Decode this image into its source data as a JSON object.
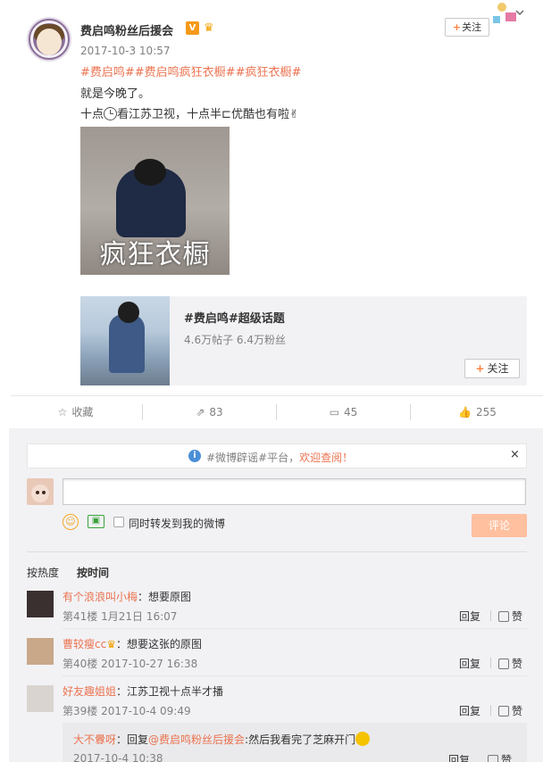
{
  "post": {
    "author": "费启鸣粉丝后援会",
    "verified_badge": "V",
    "member_badge": "♛",
    "follow_label": "关注",
    "timestamp": "2017-10-3 10:57",
    "hashtags": "#费启鸣##费启鸣疯狂衣橱##疯狂衣橱#",
    "line1": "就是今晚了。",
    "line2_a": "十点",
    "line2_b": "看江苏卫视，十点半",
    "line2_c": "优酷也有啦",
    "line2_c_glyph": "⊏",
    "peace_emoji": "✌",
    "image_caption": "疯狂衣橱"
  },
  "topic_card": {
    "title": "#费启鸣#超级话题",
    "meta": "4.6万帖子 6.4万粉丝",
    "follow_label": "关注"
  },
  "actions": {
    "favorite_label": "收藏",
    "forward_count": "83",
    "comment_count": "45",
    "like_count": "255"
  },
  "comment_box": {
    "notice_text_a": "#微博辟谣#平台，",
    "notice_text_b": "欢迎查阅！",
    "close": "×",
    "repost_label": "同时转发到我的微博",
    "submit_label": "评论",
    "placeholder": ""
  },
  "sort": {
    "by_heat": "按热度",
    "by_time": "按时间"
  },
  "comments": [
    {
      "name": "有个浪浪叫小梅",
      "text": "：想要原图",
      "meta": "第41楼 1月21日 16:07",
      "reply": "回复",
      "like": "赞"
    },
    {
      "name": "曹较瘦cc",
      "text": "：想要这张的原图",
      "meta": "第40楼 2017-10-27 16:38",
      "reply": "回复",
      "like": "赞"
    },
    {
      "name": "好友趣姐姐",
      "text": "：江苏卫视十点半才播",
      "meta": "第39楼 2017-10-4 09:49",
      "reply": "回复",
      "like": "赞"
    }
  ],
  "nested_reply": {
    "name": "大不釁呀",
    "prefix": "：回复",
    "at": "@费启鸣粉丝后援会",
    "text": ":然后我看完了芝麻开门",
    "meta": "2017-10-4 10:38",
    "reply": "回复",
    "like": "赞"
  },
  "icons": {
    "star": "☆",
    "forward": "⇗",
    "comment": "▭",
    "like": "👍",
    "info": "i",
    "emoji": "☺",
    "image": "▣"
  },
  "colors": {
    "accent": "#eb7350",
    "submit_bg": "#ffc09f",
    "verified": "#f59a1a"
  }
}
